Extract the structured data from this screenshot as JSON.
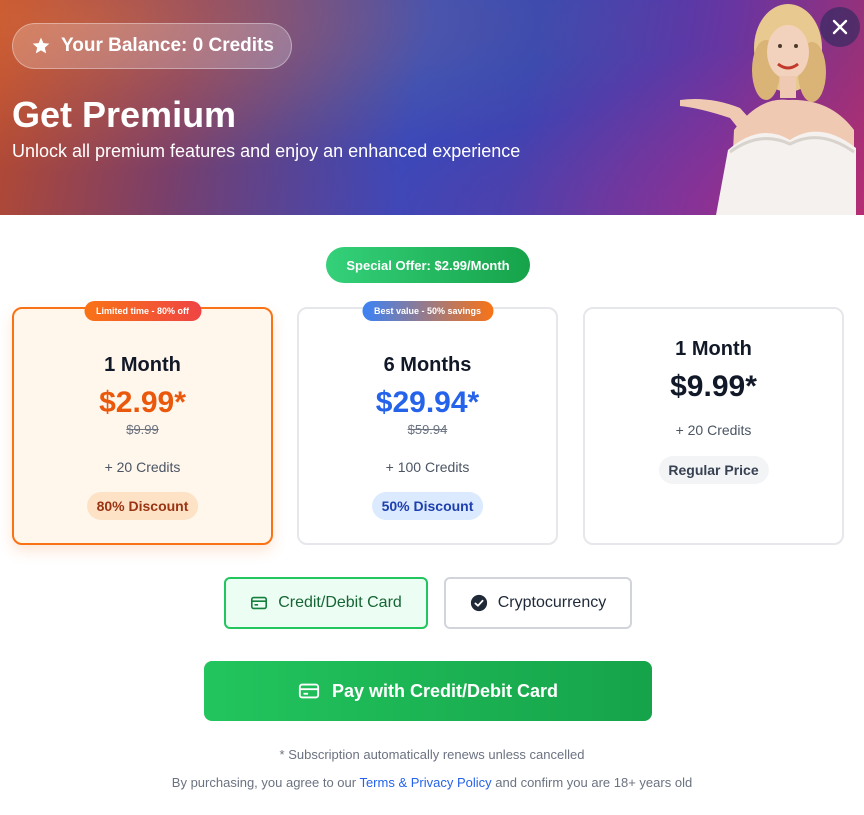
{
  "header": {
    "balance_label": "Your Balance: 0 Credits",
    "title": "Get Premium",
    "subtitle": "Unlock all premium features and enjoy an enhanced experience",
    "icons": {
      "balance": "star-icon",
      "close": "close-icon"
    }
  },
  "offer": {
    "label": "Special Offer: $2.99/Month"
  },
  "plans": [
    {
      "tag": "Limited time - 80% off",
      "name": "1 Month",
      "price": "$2.99*",
      "old_price": "$9.99",
      "credits": "+ 20 Credits",
      "badge": "80% Discount",
      "selected": true,
      "accent": "#ea580c"
    },
    {
      "tag": "Best value - 50% savings",
      "name": "6 Months",
      "price": "$29.94*",
      "old_price": "$59.94",
      "credits": "+ 100 Credits",
      "badge": "50% Discount",
      "selected": false,
      "accent": "#2563eb"
    },
    {
      "name": "1 Month",
      "price": "$9.99*",
      "credits": "+ 20 Credits",
      "badge": "Regular Price",
      "selected": false,
      "accent": "#111827"
    }
  ],
  "payment": {
    "methods": [
      {
        "label": "Credit/Debit Card",
        "icon": "credit-card-icon",
        "selected": true
      },
      {
        "label": "Cryptocurrency",
        "icon": "check-circle-icon",
        "selected": false
      }
    ],
    "pay_button": "Pay with Credit/Debit Card"
  },
  "footer": {
    "renew_note": "* Subscription automatically renews unless cancelled",
    "agree_prefix": "By purchasing, you agree to our ",
    "agree_link": "Terms & Privacy Policy",
    "agree_suffix": " and confirm you are 18+ years old"
  },
  "colors": {
    "accent_green": "#22c55e",
    "accent_orange": "#f97316",
    "accent_blue": "#2563eb"
  }
}
